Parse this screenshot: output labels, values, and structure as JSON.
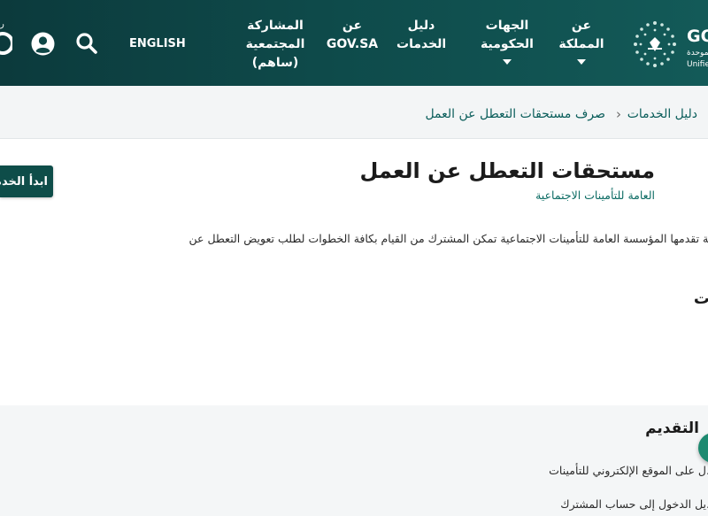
{
  "header": {
    "logo_text": "GO",
    "logo_sub_1": "الموحدة",
    "logo_sub_2": "Unifie",
    "left_logo_text": "ر",
    "nav": [
      {
        "line1": "عن",
        "line2": "المملكة",
        "line3": "",
        "has_caret": true
      },
      {
        "line1": "الجهات",
        "line2": "الحكومية",
        "line3": "",
        "has_caret": true
      },
      {
        "line1": "دليل",
        "line2": "الخدمات",
        "line3": "",
        "has_caret": false
      },
      {
        "line1": "عن",
        "line2": "GOV.SA",
        "line3": "",
        "has_caret": false
      },
      {
        "line1": "المشاركة",
        "line2": "المجتمعية",
        "line3": "(ساهم)",
        "has_caret": false
      }
    ],
    "language_toggle": "ENGLISH",
    "icons": [
      "search-icon",
      "user-icon"
    ]
  },
  "breadcrumb": {
    "items": [
      "دليل الخدمات",
      "صرف مستحقات التعطل عن العمل"
    ],
    "separator": "›"
  },
  "service": {
    "title": "مستحقات التعطل عن العمل",
    "provider": "العامة للتأمينات الاجتماعية",
    "description_line1": "نية تقدمها المؤسسة العامة للتأمينات الاجتماعية تمكن المشترك من القيام بكافة الخطوات لطلب تعويض التعطل عن",
    "description_line2": ").",
    "section_heading_partial": "ت",
    "start_button": "ابدأ الخدمة"
  },
  "steps": {
    "heading": "التقديم",
    "items": [
      "ل على الموقع الإلكتروني للتأمينات.",
      "يل الدخول إلى حساب المشترك."
    ]
  },
  "colors": {
    "header_dark": "#0c3a3c",
    "header_light": "#135a58",
    "accent_text": "#0b5e5b",
    "button": "#0e4d49",
    "fab": "#1d8a70"
  }
}
